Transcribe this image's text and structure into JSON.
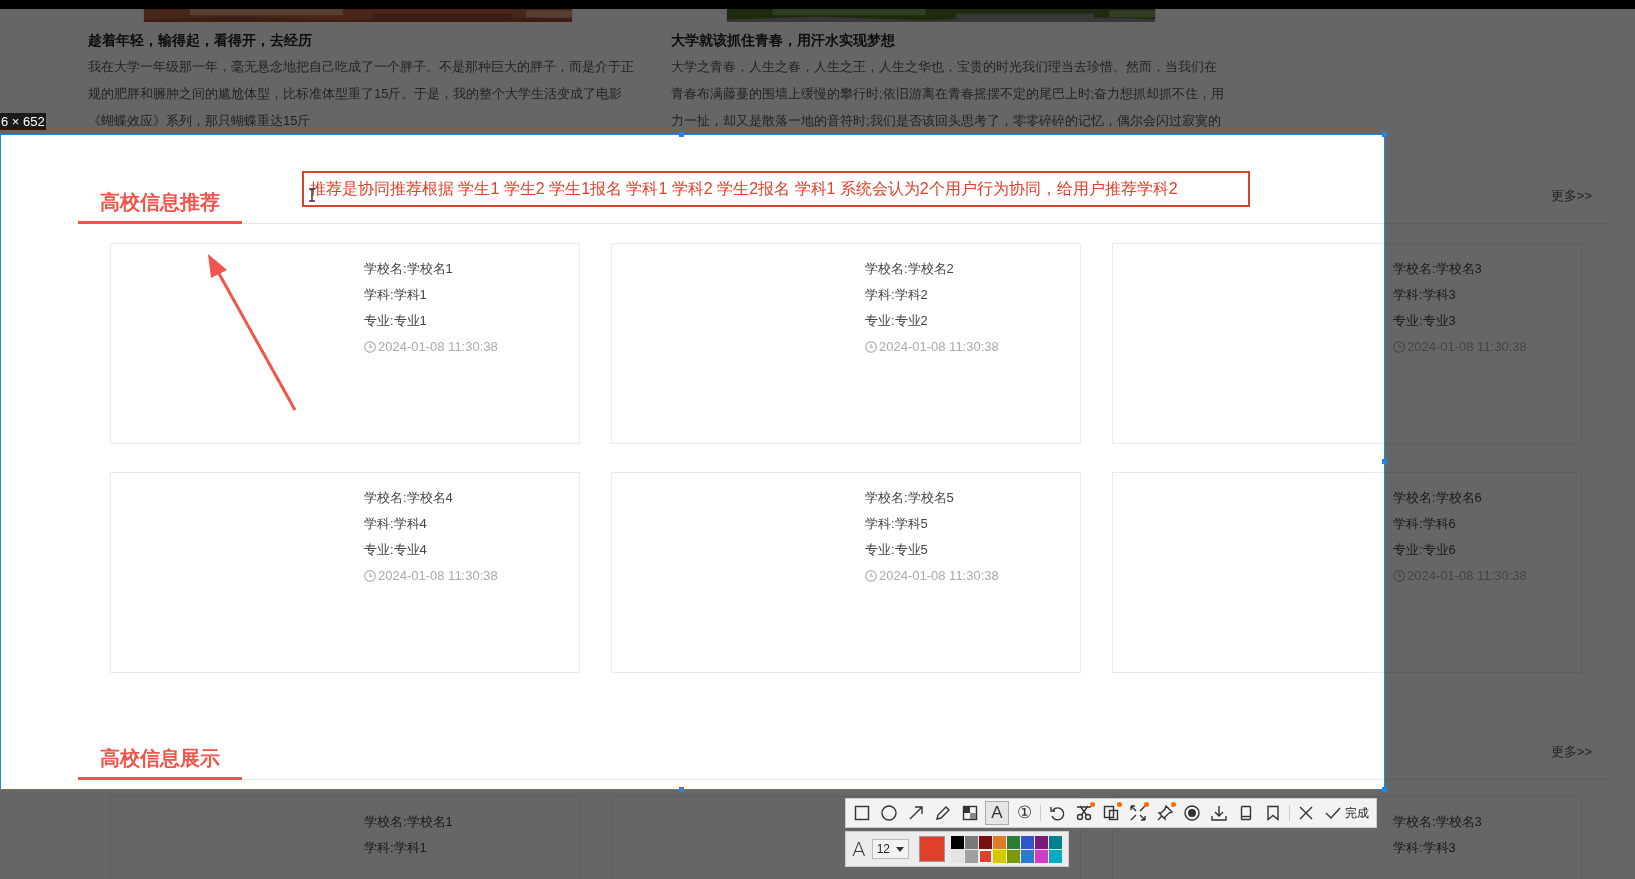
{
  "articles": [
    {
      "title": "趁着年轻，输得起，看得开，去经历",
      "lines": [
        "我在大学一年级那一年，毫无悬念地把自己吃成了一个胖子。不是那种巨大的胖子，而是介于正",
        "规的肥胖和臃肿之间的尴尬体型，比标准体型重了15斤。于是，我的整个大学生活变成了电影",
        "《蝴蝶效应》系列，那只蝴蝶重达15斤"
      ]
    },
    {
      "title": "大学就该抓住青春，用汗水实现梦想",
      "lines": [
        "大学之青春，人生之春，人生之王，人生之华也，宝贵的时光我们理当去珍惜。然而，当我们在",
        "青春布满藤蔓的围墙上缓慢的攀行时;依旧游离在青春摇摆不定的尾巴上时;奋力想抓却抓不住，用",
        "力一扯，却又是散落一地的音符时;我们是否该回头思考了，零零碎碎的记忆，偶尔会闪过寂寞的"
      ]
    }
  ],
  "size_label": "6 × 652",
  "sections": [
    {
      "title": "高校信息推荐",
      "more": "更多>>",
      "cards": [
        {
          "kind": "card",
          "school": "学校名:学校名1",
          "subject": "学科:学科1",
          "major": "专业:专业1",
          "time": "2024-01-08 11:30:38"
        },
        {
          "kind": "card",
          "school": "学校名:学校名2",
          "subject": "学科:学科2",
          "major": "专业:专业2",
          "time": "2024-01-08 11:30:38"
        },
        {
          "kind": "card",
          "school": "学校名:学校名3",
          "subject": "学科:学科3",
          "major": "专业:专业3",
          "time": "2024-01-08 11:30:38"
        },
        {
          "kind": "card",
          "school": "学校名:学校名4",
          "subject": "学科:学科4",
          "major": "专业:专业4",
          "time": "2024-01-08 11:30:38"
        },
        {
          "kind": "card",
          "school": "学校名:学校名5",
          "subject": "学科:学科5",
          "major": "专业:专业5",
          "time": "2024-01-08 11:30:38"
        },
        {
          "kind": "card",
          "school": "学校名:学校名6",
          "subject": "学科:学科6",
          "major": "专业:专业6",
          "time": "2024-01-08 11:30:38"
        }
      ]
    },
    {
      "title": "高校信息展示",
      "more": "更多>>",
      "cards": [
        {
          "kind": "card",
          "school": "学校名:学校名1",
          "subject": "学科:学科1"
        },
        {
          "kind": "card"
        },
        {
          "kind": "card",
          "school": "学校名:学校名3",
          "subject": "学科:学科3"
        }
      ]
    }
  ],
  "annotation": {
    "text": "推荐是协同推荐根据 学生1 学生2 学生1报名 学科1 学科2 学生2报名 学科1  系统会认为2个用户行为协同，给用户推荐学科2"
  },
  "toolbar": {
    "tools": [
      {
        "kind": "rect",
        "selected": false
      },
      {
        "kind": "ellipse",
        "selected": false
      },
      {
        "kind": "arrow",
        "selected": false
      },
      {
        "kind": "pencil",
        "selected": false
      },
      {
        "kind": "mosaic",
        "selected": false
      },
      {
        "kind": "text",
        "label": "A",
        "selected": true
      },
      {
        "kind": "number",
        "label": "①",
        "selected": false
      },
      {
        "kind": "separator"
      },
      {
        "kind": "undo",
        "selected": false
      },
      {
        "kind": "scissors",
        "selected": false,
        "dot": true
      },
      {
        "kind": "document",
        "selected": false,
        "dot": true
      },
      {
        "kind": "expand",
        "selected": false,
        "dot": true
      },
      {
        "kind": "pin",
        "selected": false,
        "dot": true
      },
      {
        "kind": "record",
        "selected": false
      },
      {
        "kind": "download",
        "selected": false
      },
      {
        "kind": "phone",
        "selected": false
      },
      {
        "kind": "bookmark",
        "selected": false
      },
      {
        "kind": "separator"
      },
      {
        "kind": "close",
        "selected": false
      },
      {
        "kind": "done",
        "label": "完成",
        "selected": false
      }
    ],
    "font_label": "A",
    "font_size": "12",
    "colors": [
      {
        "color": "#000000",
        "selected": false
      },
      {
        "color": "#7a7a7a",
        "selected": false
      },
      {
        "color": "#7a0f0f",
        "selected": false
      },
      {
        "color": "#e07b2a",
        "selected": false
      },
      {
        "color": "#2e7d32",
        "selected": false
      },
      {
        "color": "#2f55c8",
        "selected": false
      },
      {
        "color": "#7b1a7b",
        "selected": false
      },
      {
        "color": "#00838f",
        "selected": false
      },
      {
        "color": "#e4e4e4",
        "selected": false
      },
      {
        "color": "#a0a0a0",
        "selected": false
      },
      {
        "color": "#e0402a",
        "selected": true
      },
      {
        "color": "#d4c800",
        "selected": false
      },
      {
        "color": "#7a9a00",
        "selected": false
      },
      {
        "color": "#2a7ad0",
        "selected": false
      },
      {
        "color": "#d23cc8",
        "selected": false
      },
      {
        "color": "#00acc1",
        "selected": false
      }
    ]
  }
}
